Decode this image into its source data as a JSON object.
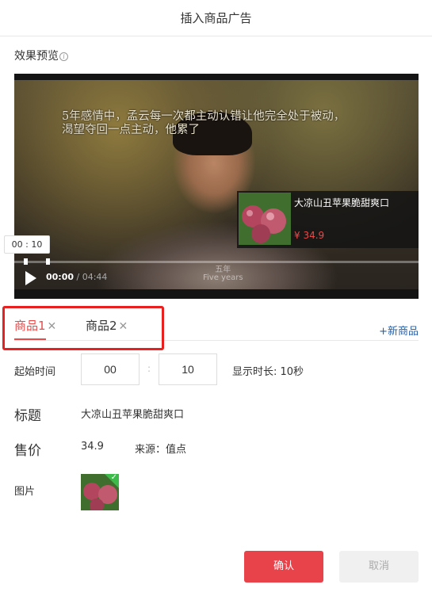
{
  "dialog": {
    "title": "插入商品广告"
  },
  "preview": {
    "label": "效果预览",
    "subtitle_line1": "5年感情中，孟云每一次都主动认错让他完全处于被动，",
    "subtitle_line2": "渴望夺回一点主动，他累了",
    "watermark_line1": "五年",
    "watermark_line2": "Five years",
    "tooltip_time": "00 : 10",
    "current_time": "00:00",
    "total_time": "/ 04:44",
    "product_card": {
      "name": "大凉山丑苹果脆甜爽口",
      "price": "¥ 34.9"
    }
  },
  "tabs": [
    {
      "label": "商品1",
      "active": true
    },
    {
      "label": "商品2",
      "active": false
    }
  ],
  "add_product_label": "+新商品",
  "form": {
    "start_time_label": "起始时间",
    "start_minutes": "00",
    "start_seconds": "10",
    "duration_text": "显示时长: 10秒",
    "title_label": "标题",
    "title_value": "大凉山丑苹果脆甜爽口",
    "price_label": "售价",
    "price_value": "34.9",
    "source_text": "来源：值点",
    "image_label": "图片"
  },
  "buttons": {
    "confirm": "确认",
    "cancel": "取消"
  },
  "colors": {
    "accent": "#e8424a",
    "link": "#2b5fa3",
    "check": "#3dbb4a"
  }
}
